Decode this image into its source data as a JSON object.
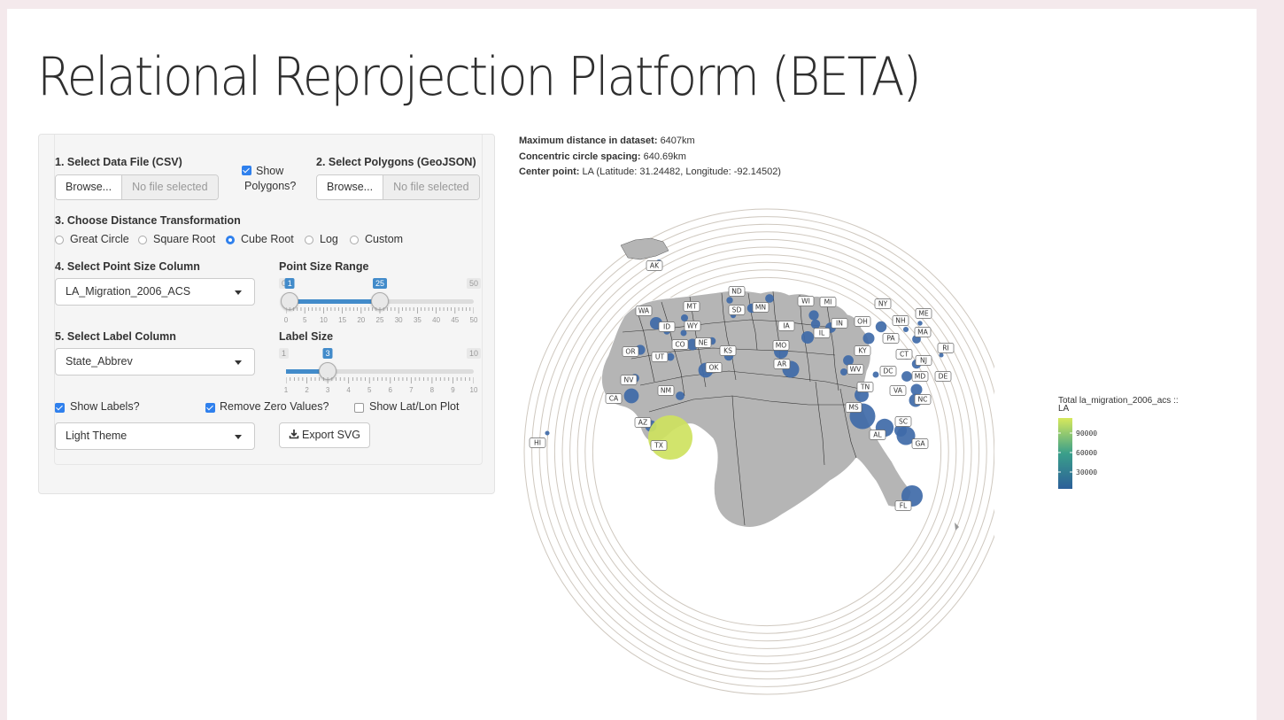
{
  "page": {
    "title": "Relational Reprojection Platform (BETA)"
  },
  "controls": {
    "data_file": {
      "label": "1. Select Data File (CSV)",
      "button": "Browse...",
      "placeholder": "No file selected"
    },
    "show_polygons": {
      "label_line1": "Show",
      "label_line2": "Polygons?",
      "checked": true
    },
    "polygons": {
      "label": "2. Select Polygons (GeoJSON)",
      "button": "Browse...",
      "placeholder": "No file selected"
    },
    "distance": {
      "label": "3. Choose Distance Transformation",
      "options": [
        "Great Circle",
        "Square Root",
        "Cube Root",
        "Log",
        "Custom"
      ],
      "selected": "Cube Root"
    },
    "point_size_column": {
      "label": "4. Select Point Size Column",
      "value": "LA_Migration_2006_ACS"
    },
    "point_size_range": {
      "label": "Point Size Range",
      "min": 0,
      "max": 50,
      "low": 1,
      "high": 25,
      "low_label": "1",
      "high_label": "25",
      "min_label": "0",
      "max_label": "50",
      "ticks": [
        "0",
        "5",
        "10",
        "15",
        "20",
        "25",
        "30",
        "35",
        "40",
        "45",
        "50"
      ]
    },
    "label_column": {
      "label": "5. Select Label Column",
      "value": "State_Abbrev"
    },
    "label_size": {
      "label": "Label Size",
      "min": 1,
      "max": 10,
      "value": 3,
      "value_label": "3",
      "min_label": "1",
      "max_label": "10",
      "ticks": [
        "1",
        "2",
        "3",
        "4",
        "5",
        "6",
        "7",
        "8",
        "9",
        "10"
      ]
    },
    "show_labels": {
      "label": "Show Labels?",
      "checked": true
    },
    "remove_zero": {
      "label": "Remove Zero Values?",
      "checked": true
    },
    "show_latlon": {
      "label": "Show Lat/Lon Plot",
      "checked": false
    },
    "theme": {
      "value": "Light Theme"
    },
    "export": {
      "label": "Export SVG"
    }
  },
  "info": {
    "max_distance": {
      "label": "Maximum distance in dataset:",
      "value": "6407km"
    },
    "circle_spacing": {
      "label": "Concentric circle spacing:",
      "value": "640.69km"
    },
    "center_point": {
      "label": "Center point:",
      "value": "LA (Latitude: 31.24482, Longitude: -92.14502)"
    }
  },
  "legend": {
    "title_line1": "Total la_migration_2006_acs ::",
    "title_line2": "LA",
    "ticks": [
      "90000",
      "60000",
      "30000"
    ],
    "color_low": "#2c5f99",
    "color_high": "#d7e95c"
  },
  "map": {
    "ring_count": 10,
    "ring_color": "#cfc8bf",
    "land_color": "#b5b5b5",
    "point_color": "#3f6aa8",
    "states": [
      {
        "abbr": "AK",
        "value": 700
      },
      {
        "abbr": "WA",
        "value": 6000
      },
      {
        "abbr": "MT",
        "value": 1500
      },
      {
        "abbr": "ND",
        "value": 1200
      },
      {
        "abbr": "SD",
        "value": 800
      },
      {
        "abbr": "MN",
        "value": 3000
      },
      {
        "abbr": "WI",
        "value": 2500
      },
      {
        "abbr": "MI",
        "value": 3500
      },
      {
        "abbr": "NY",
        "value": 4500
      },
      {
        "abbr": "ID",
        "value": 1200
      },
      {
        "abbr": "WY",
        "value": 1000
      },
      {
        "abbr": "IA",
        "value": 2000
      },
      {
        "abbr": "IN",
        "value": 3000
      },
      {
        "abbr": "OH",
        "value": 4000
      },
      {
        "abbr": "NH",
        "value": 700
      },
      {
        "abbr": "ME",
        "value": 500
      },
      {
        "abbr": "MA",
        "value": 2500
      },
      {
        "abbr": "OR",
        "value": 3500
      },
      {
        "abbr": "CO",
        "value": 5000
      },
      {
        "abbr": "NE",
        "value": 1800
      },
      {
        "abbr": "IL",
        "value": 6000
      },
      {
        "abbr": "PA",
        "value": 5000
      },
      {
        "abbr": "RI",
        "value": 400
      },
      {
        "abbr": "UT",
        "value": 2000
      },
      {
        "abbr": "KS",
        "value": 3000
      },
      {
        "abbr": "MO",
        "value": 8000
      },
      {
        "abbr": "KY",
        "value": 4000
      },
      {
        "abbr": "CT",
        "value": 1500
      },
      {
        "abbr": "NJ",
        "value": 3000
      },
      {
        "abbr": "AR",
        "value": 12000
      },
      {
        "abbr": "WV",
        "value": 1500
      },
      {
        "abbr": "DC",
        "value": 1000
      },
      {
        "abbr": "NV",
        "value": 2500
      },
      {
        "abbr": "OK",
        "value": 9000
      },
      {
        "abbr": "MD",
        "value": 4000
      },
      {
        "abbr": "DE",
        "value": 600
      },
      {
        "abbr": "NM",
        "value": 2500
      },
      {
        "abbr": "TN",
        "value": 8000
      },
      {
        "abbr": "VA",
        "value": 5000
      },
      {
        "abbr": "NC",
        "value": 7000
      },
      {
        "abbr": "CA",
        "value": 9000
      },
      {
        "abbr": "MS",
        "value": 30000
      },
      {
        "abbr": "AZ",
        "value": 5000
      },
      {
        "abbr": "SC",
        "value": 6000
      },
      {
        "abbr": "AL",
        "value": 14000
      },
      {
        "abbr": "GA",
        "value": 15000
      },
      {
        "abbr": "TX",
        "value": 95000
      },
      {
        "abbr": "FL",
        "value": 20000
      },
      {
        "abbr": "HI",
        "value": 400
      }
    ]
  }
}
